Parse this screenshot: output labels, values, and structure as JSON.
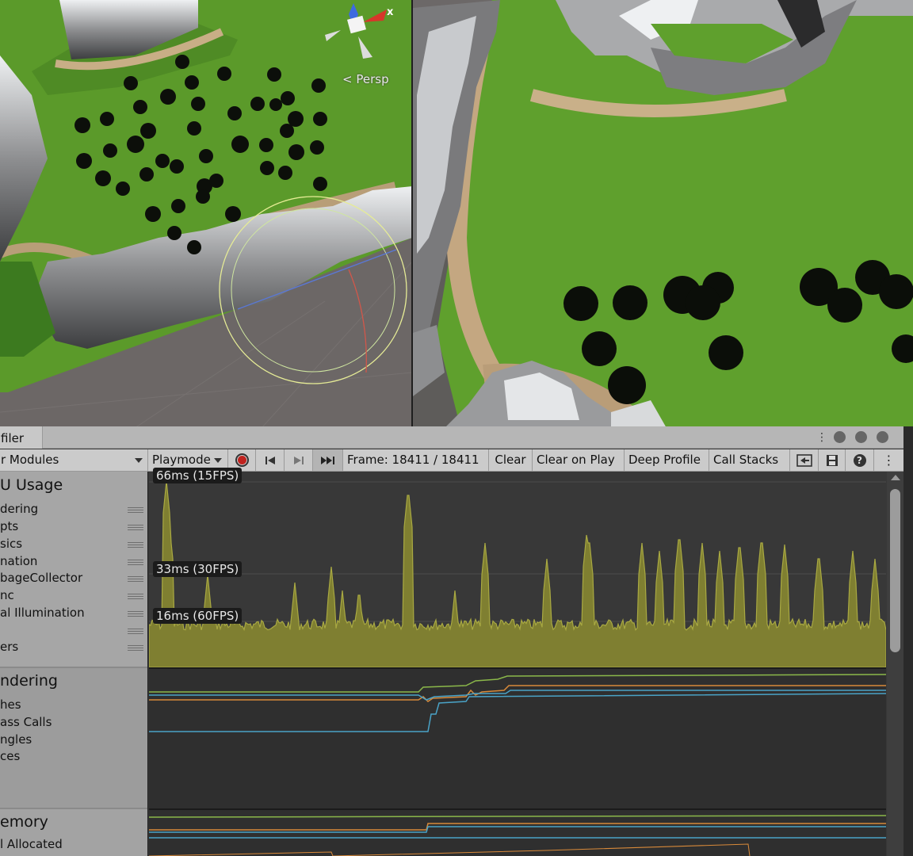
{
  "scene_view": {
    "projection_label": "Persp",
    "gizmo_axis_label": "x"
  },
  "profiler": {
    "tab_title": "filer",
    "window_menu_icon": "kebab-icon",
    "toolbar": {
      "modules_dropdown": "r Modules",
      "target_dropdown": "Playmode",
      "frame_label": "Frame: 18411 / 18411",
      "clear": "Clear",
      "clear_on_play": "Clear on Play",
      "deep_profile": "Deep Profile",
      "call_stacks": "Call Stacks"
    },
    "modules": [
      {
        "title": "U Usage",
        "items": [
          "dering",
          "pts",
          "sics",
          "nation",
          "bageCollector",
          "nc",
          "al Illumination",
          "",
          "ers"
        ]
      },
      {
        "title": "ndering",
        "items": [
          "hes",
          "ass Calls",
          "ngles",
          "ces"
        ]
      },
      {
        "title": "emory",
        "items": [
          "l Allocated"
        ]
      }
    ],
    "cpu_chart_labels": {
      "fps15": "66ms (15FPS)",
      "fps30": "33ms (30FPS)",
      "fps60": "16ms (60FPS)"
    },
    "colors": {
      "cpu_fill": "#7f7f31",
      "cpu_line": "#a9a942",
      "series_green": "#8bb84a",
      "series_orange": "#d98a3a",
      "series_blue": "#4aa3c7",
      "record_red": "#c0231f"
    }
  }
}
